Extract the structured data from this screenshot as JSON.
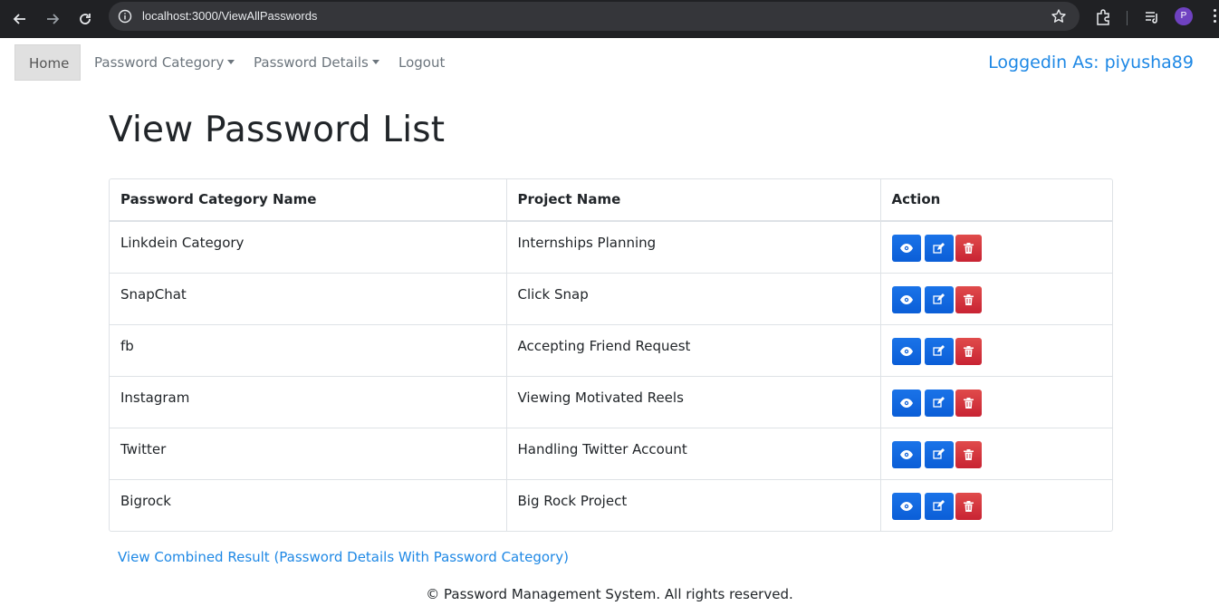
{
  "browser": {
    "url": "localhost:3000/ViewAllPasswords",
    "profile_initial": "P"
  },
  "navbar": {
    "home": "Home",
    "password_category": "Password Category",
    "password_details": "Password Details",
    "logout": "Logout",
    "logged_in": "Loggedin As: piyusha89"
  },
  "page": {
    "title": "View Password List",
    "combined_link": "View Combined Result (Password Details With Password Category)",
    "footer": "© Password Management System. All rights reserved."
  },
  "table": {
    "headers": [
      "Password Category Name",
      "Project Name",
      "Action"
    ],
    "rows": [
      {
        "category": "Linkdein Category",
        "project": "Internships Planning"
      },
      {
        "category": "SnapChat",
        "project": "Click Snap"
      },
      {
        "category": "fb",
        "project": "Accepting Friend Request"
      },
      {
        "category": "Instagram",
        "project": "Viewing Motivated Reels"
      },
      {
        "category": "Twitter",
        "project": "Handling Twitter Account"
      },
      {
        "category": "Bigrock",
        "project": "Big Rock Project"
      }
    ]
  },
  "icons": {
    "view": "eye-icon",
    "edit": "edit-icon",
    "delete": "trash-icon"
  },
  "colors": {
    "primary_button": "#0b5ed7",
    "danger_button": "#c82333",
    "link": "#1e88e5"
  }
}
